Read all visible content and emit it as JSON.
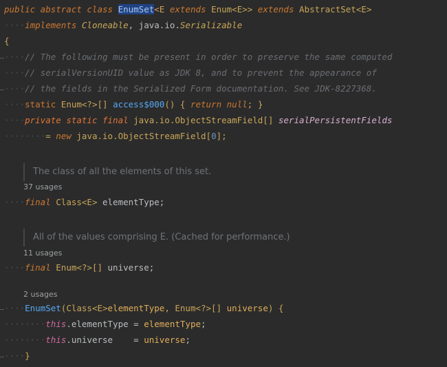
{
  "lines": {
    "l1": {
      "t1": "public abstract class ",
      "t2": "EnumSet",
      "t3": "<E ",
      "t4": "extends ",
      "t5": "Enum<E>> ",
      "t6": "extends ",
      "t7": "AbstractSet<E>"
    },
    "l2": {
      "indent": "····",
      "t1": "implements ",
      "t2": "Cloneable",
      "t3": ", java.io.",
      "t4": "Serializable"
    },
    "l3": {
      "t1": "{"
    },
    "l4": {
      "indent": "····",
      "t1": "// The following must be present in order to preserve the same computed"
    },
    "l5": {
      "indent": "····",
      "t1": "// serialVersionUID value as JDK 8, and to prevent the appearance of"
    },
    "l6": {
      "indent": "····",
      "t1": "// the fields in the Serialized Form documentation. See JDK-8227368."
    },
    "l7": {
      "indent": "····",
      "t1": "static ",
      "t2": "Enum<?>[] ",
      "t3": "access$000",
      "t4": "() { ",
      "t5": "return ",
      "t6": "null",
      "t7": "; }"
    },
    "l8": {
      "indent": "····",
      "t1": "private static final ",
      "t2": "java.io.ObjectStreamField[] ",
      "t3": "serialPersistentFields"
    },
    "l9": {
      "indent": "········",
      "t1": "= ",
      "t2": "new ",
      "t3": "java.io.ObjectStreamField[",
      "t4": "0",
      "t5": "];"
    },
    "l10": {
      "indent": "····",
      "t1": "final ",
      "t2": "Class<E> ",
      "t3": "elementType;"
    },
    "l11": {
      "indent": "····",
      "t1": "final ",
      "t2": "Enum<?>[] ",
      "t3": "universe;"
    },
    "l12": {
      "indent": "····",
      "t1": "EnumSet",
      "t2": "(Class<E>",
      "t3": "elementType",
      "t4": ", Enum<?>[] ",
      "t5": "universe",
      "t6": ") {"
    },
    "l13": {
      "indent": "········",
      "t1": "this",
      "t2": ".elementType = ",
      "t3": "elementType",
      "t4": ";"
    },
    "l14": {
      "indent": "········",
      "t1": "this",
      "t2": ".universe    = ",
      "t3": "universe",
      "t4": ";"
    },
    "l15": {
      "indent": "····",
      "t1": "}"
    }
  },
  "docs": {
    "d1": "The class of all the elements of this set.",
    "d2": "All of the values comprising E. (Cached for performance.)"
  },
  "hints": {
    "h1": "37 usages",
    "h2": "11 usages",
    "h3": "2 usages"
  }
}
